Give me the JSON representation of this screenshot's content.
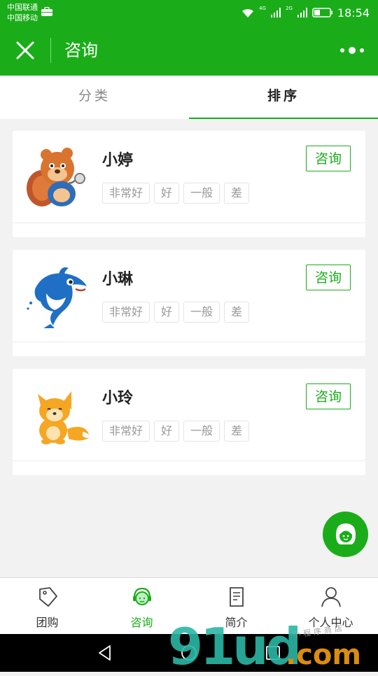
{
  "status_bar": {
    "carrier_1": "中国联通",
    "carrier_2": "中国移动",
    "net_1": "4G",
    "net_2": "2G",
    "time": "18:54"
  },
  "title_bar": {
    "title": "咨询"
  },
  "tabs": [
    {
      "label": "分类",
      "active": false
    },
    {
      "label": "排序",
      "active": true
    }
  ],
  "consultants": [
    {
      "name": "小婷",
      "avatar": "squirrel-avatar",
      "button": "咨询",
      "ratings": [
        "非常好",
        "好",
        "一般",
        "差"
      ]
    },
    {
      "name": "小琳",
      "avatar": "dolphin-avatar",
      "button": "咨询",
      "ratings": [
        "非常好",
        "好",
        "一般",
        "差"
      ]
    },
    {
      "name": "小玲",
      "avatar": "fox-avatar",
      "button": "咨询",
      "ratings": [
        "非常好",
        "好",
        "一般",
        "差"
      ]
    }
  ],
  "fab": {
    "icon": "customer-service-icon"
  },
  "bottom_nav": [
    {
      "label": "团购",
      "icon": "tag-icon",
      "active": false
    },
    {
      "label": "咨询",
      "icon": "headset-icon",
      "active": true
    },
    {
      "label": "简介",
      "icon": "document-icon",
      "active": false
    },
    {
      "label": "个人中心",
      "icon": "user-icon",
      "active": false
    }
  ],
  "watermark": {
    "main": "91ud",
    "suffix": ".com",
    "small": "小程序商店"
  },
  "colors": {
    "primary": "#1aad19",
    "background": "#f2f2f2",
    "tag_border": "#e4e4e4",
    "tag_text": "#999999"
  }
}
